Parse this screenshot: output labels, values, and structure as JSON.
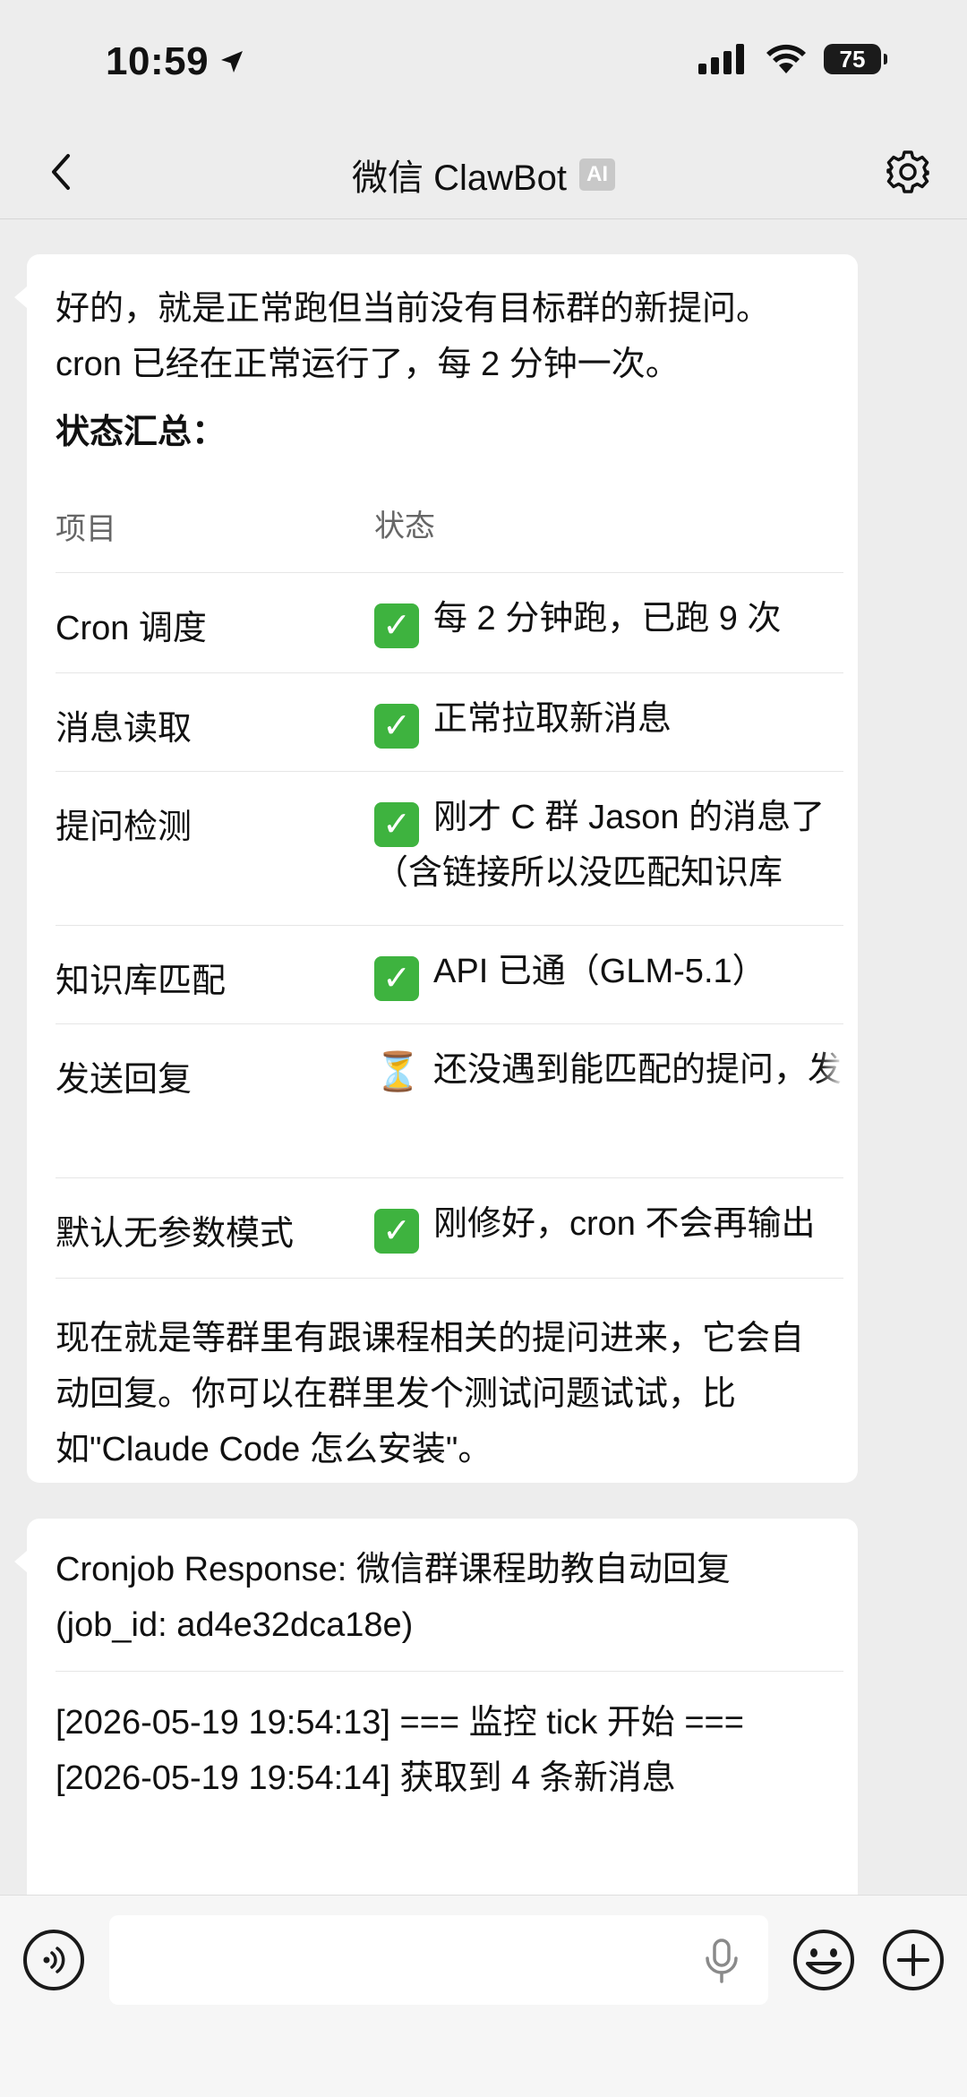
{
  "status_bar": {
    "time": "10:59",
    "battery": "75"
  },
  "header": {
    "title": "微信 ClawBot",
    "badge": "AI"
  },
  "message1": {
    "intro": "好的，就是正常跑但当前没有目标群的新提问。cron 已经在正常运行了，每 2 分钟一次。",
    "summary_title": "状态汇总：",
    "table": {
      "headers": [
        "项目",
        "状态"
      ],
      "rows": [
        {
          "item": "Cron 调度",
          "icon": "check",
          "status": "每 2 分钟跑，已跑 9 次"
        },
        {
          "item": "消息读取",
          "icon": "check",
          "status": "正常拉取新消息"
        },
        {
          "item": "提问检测",
          "icon": "check",
          "status": "刚才 C 群 Jason 的消息了（含链接所以没匹配知识库"
        },
        {
          "item": "知识库匹配",
          "icon": "check",
          "status": "API 已通（GLM-5.1）"
        },
        {
          "item": "发送回复",
          "icon": "hourglass",
          "status": "还没遇到能匹配的提问，发"
        },
        {
          "item": "默认无参数模式",
          "icon": "check",
          "status": "刚修好，cron 不会再输出"
        }
      ]
    },
    "closing": "现在就是等群里有跟课程相关的提问进来，它会自动回复。你可以在群里发个测试问题试试，比如\"Claude Code 怎么安装\"。"
  },
  "message2": {
    "title": "Cronjob Response: 微信群课程助教自动回复 (job_id: ad4e32dca18e)",
    "log_lines": [
      "[2026-05-19 19:54:13] === 监控 tick 开始 ===",
      "[2026-05-19 19:54:14] 获取到 4 条新消息"
    ]
  }
}
